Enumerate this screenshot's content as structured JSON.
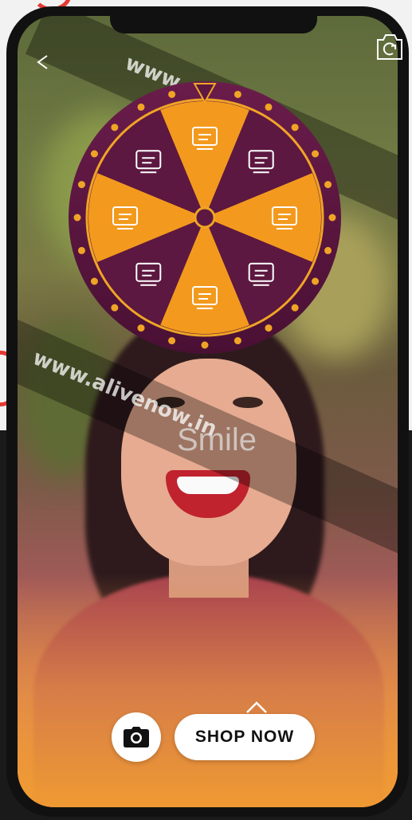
{
  "watermarks": [
    "www.alivenow.in",
    "www.alivenow.in"
  ],
  "ar_prompt": "Smile",
  "wheel": {
    "segments": [
      {
        "icon": "laptop-discount-icon",
        "color": "#f39a1e"
      },
      {
        "icon": "shopping-cart-icon",
        "color": "#5c1840"
      },
      {
        "icon": "cash-register-icon",
        "color": "#f39a1e"
      },
      {
        "icon": "cycle-tag-icon",
        "color": "#5c1840"
      },
      {
        "icon": "badge-pennant-icon",
        "color": "#f39a1e"
      },
      {
        "icon": "mobile-devices-icon",
        "color": "#5c1840"
      },
      {
        "icon": "shopping-cart-icon",
        "color": "#f39a1e"
      },
      {
        "icon": "shopping-cart-icon",
        "color": "#5c1840"
      }
    ],
    "rim_color": "#5c1840",
    "dot_color": "#f0a426"
  },
  "actions": {
    "shop_label": "SHOP NOW",
    "camera_icon": "camera-icon",
    "expand_icon": "chevron-up-icon"
  },
  "nav": {
    "back_icon": "back-arrow-icon",
    "switch_camera_icon": "switch-camera-icon"
  }
}
